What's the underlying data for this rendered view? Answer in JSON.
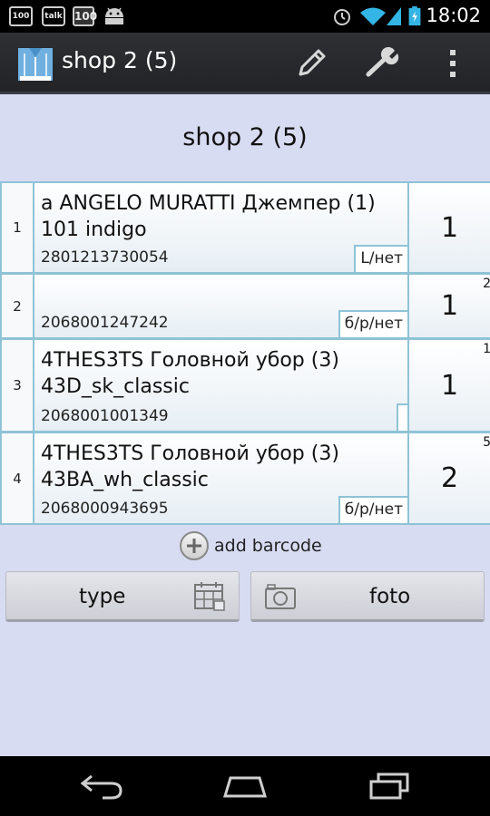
{
  "status_bar": {
    "badges": [
      "100",
      "talk",
      "100"
    ],
    "time": "18:02"
  },
  "action_bar": {
    "title": "shop 2 (5)",
    "icons": [
      "pencil-icon",
      "wrench-icon",
      "overflow-menu-icon"
    ]
  },
  "page": {
    "title": "shop 2 (5)"
  },
  "rows": [
    {
      "index": "1",
      "name": "a ANGELO MURATTI Джемпер (1) 101 indigo",
      "barcode": "2801213730054",
      "size": "L/нет",
      "qty": "1",
      "stock": ""
    },
    {
      "index": "2",
      "name": "",
      "barcode": "2068001247242",
      "size": "б/р/нет",
      "qty": "1",
      "stock": "2"
    },
    {
      "index": "3",
      "name": "4THES3TS Головной убор (3) 43D_sk_classic",
      "barcode": "2068001001349",
      "size": "",
      "qty": "1",
      "stock": "1"
    },
    {
      "index": "4",
      "name": "4THES3TS Головной убор (3) 43BA_wh_classic",
      "barcode": "2068000943695",
      "size": "б/р/нет",
      "qty": "2",
      "stock": "5"
    }
  ],
  "add_barcode_label": "add barcode",
  "buttons": {
    "type_label": "type",
    "foto_label": "foto"
  },
  "colors": {
    "background": "#d8dcf2",
    "row_border": "#8ec3d6",
    "action_bar": "#2a2c30"
  }
}
